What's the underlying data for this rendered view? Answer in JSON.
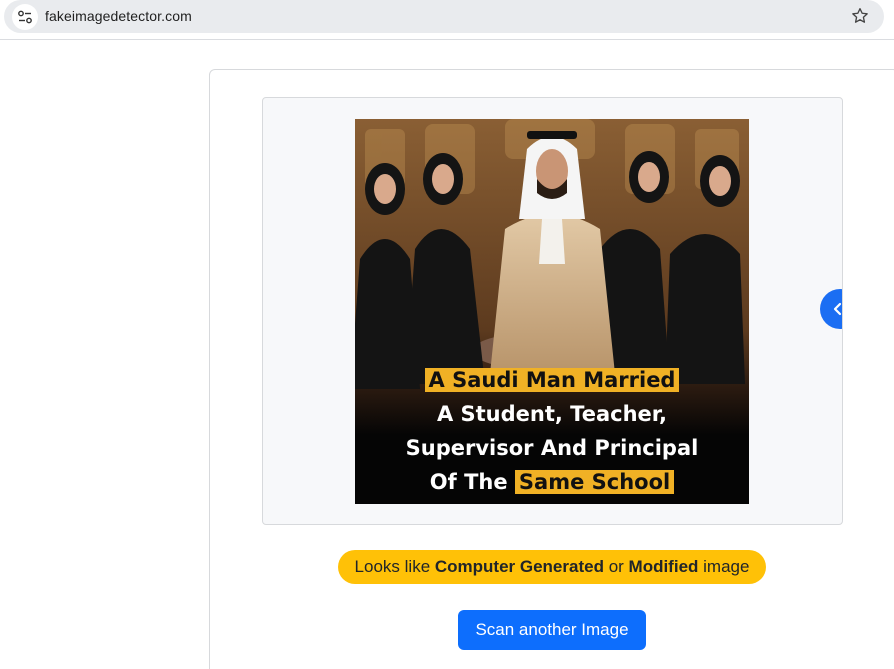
{
  "browser": {
    "url": "fakeimagedetector.com",
    "site_info_icon": "tune-icon",
    "bookmark_icon": "star-icon"
  },
  "image": {
    "caption": {
      "line1_highlight": "A Saudi Man Married",
      "line2": "A Student, Teacher,",
      "line3": "Supervisor And Principal",
      "line4_prefix": "Of The ",
      "line4_highlight": "Same School"
    },
    "highlight_color": "#f0b125"
  },
  "carousel": {
    "next_icon": "chevron-left-icon"
  },
  "result": {
    "prefix": "Looks like ",
    "bold1": "Computer Generated",
    "middle": " or ",
    "bold2": "Modified",
    "suffix": " image",
    "badge_color": "#ffc107"
  },
  "actions": {
    "scan_label": "Scan another Image",
    "button_color": "#0d6efd"
  }
}
